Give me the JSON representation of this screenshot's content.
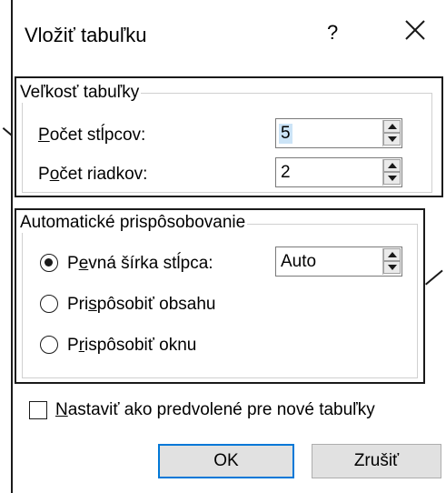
{
  "dialog": {
    "title": "Vložiť tabuľku",
    "help_label": "?",
    "close_icon": "close-icon"
  },
  "size_group": {
    "legend": "Veľkosť tabuľky",
    "columns": {
      "label_accel": "P",
      "label_rest": "očet stĺpcov:",
      "value": "5"
    },
    "rows": {
      "label_before": "P",
      "label_accel": "o",
      "label_rest": "čet riadkov:",
      "value": "2"
    }
  },
  "auto_group": {
    "legend": "Automatické prispôsobovanie",
    "fixed_width": {
      "label_before": "P",
      "label_accel": "e",
      "label_rest": "vná šírka stĺpca:",
      "value": "Auto",
      "selected": true
    },
    "fit_content": {
      "label_before": "Pri",
      "label_accel": "s",
      "label_rest": "pôsobiť obsahu",
      "selected": false
    },
    "fit_window": {
      "label_before": "P",
      "label_accel": "r",
      "label_rest": "ispôsobiť oknu",
      "selected": false
    }
  },
  "default_checkbox": {
    "label_accel": "N",
    "label_rest": "astaviť ako predvolené pre nové tabuľky",
    "checked": false
  },
  "buttons": {
    "ok": "OK",
    "cancel": "Zrušiť"
  },
  "colors": {
    "selection": "#cce4f7",
    "default_button_border": "#0078d7"
  }
}
